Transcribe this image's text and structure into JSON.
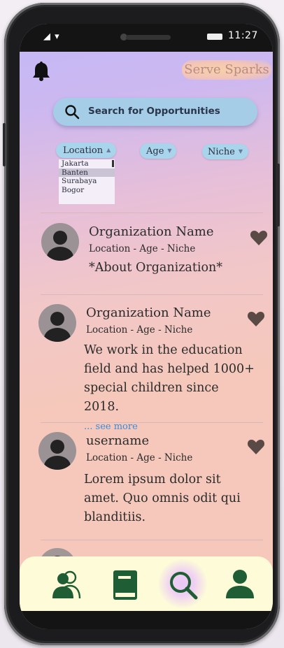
{
  "status_bar": {
    "time": "11:27",
    "signal": "◢ ▾",
    "battery": ""
  },
  "header": {
    "brand": "Serve Sparks"
  },
  "search": {
    "placeholder": "Search for Opportunities"
  },
  "filters": {
    "location": {
      "label": "Location",
      "caret": "▲"
    },
    "age": {
      "label": "Age",
      "caret": "▼"
    },
    "niche": {
      "label": "Niche",
      "caret": "▼"
    },
    "location_options": [
      "Jakarta",
      "Banten",
      "Surabaya",
      "Bogor"
    ],
    "location_selected": "Banten"
  },
  "cards": [
    {
      "name": "Organization Name",
      "meta": "Location - Age - Niche",
      "description": "*About Organization*",
      "see_more": ""
    },
    {
      "name": "Organization Name",
      "meta": "Location - Age - Niche",
      "description": "We work in the education field and has helped 1000+ special children since 2018.",
      "see_more": "... see more"
    },
    {
      "name": "username",
      "meta": "Location - Age - Niche",
      "description": "Lorem ipsum dolor sit amet. Quo omnis odit qui blanditiis.",
      "see_more": ""
    }
  ],
  "nav": {
    "items": [
      "people-icon",
      "book-icon",
      "search-icon",
      "profile-icon"
    ],
    "active": "search-icon"
  },
  "colors": {
    "accent_green": "#1f5e34",
    "heart": "#5a4a45",
    "search_bg": "#a6cde8",
    "nav_bg": "#fdfbd8"
  }
}
